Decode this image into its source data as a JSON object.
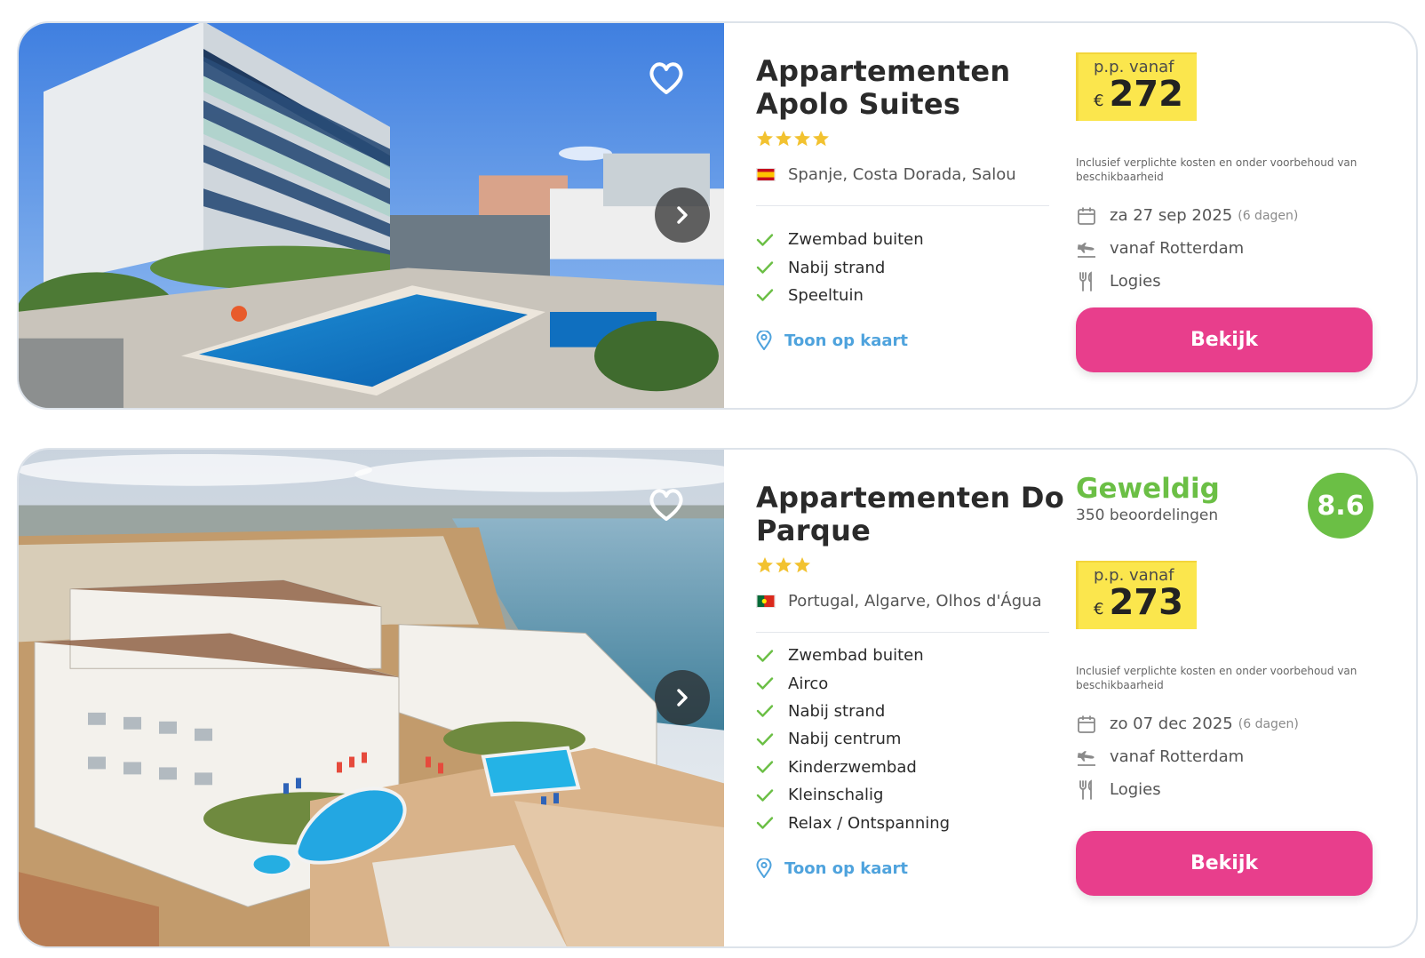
{
  "hotels": [
    {
      "name": "Appartementen Apolo Suites",
      "stars": 4,
      "flag": "es",
      "location": "Spanje, Costa Dorada, Salou",
      "features": [
        "Zwembad buiten",
        "Nabij strand",
        "Speeltuin"
      ],
      "map_link": "Toon op kaart",
      "price_label": "p.p. vanaf",
      "currency": "€",
      "price": "272",
      "disclaimer": "Inclusief verplichte kosten en onder voorbehoud van beschikbaarheid",
      "date": "za 27 sep 2025",
      "duration": "(6 dagen)",
      "departure": "vanaf Rotterdam",
      "board": "Logies",
      "button": "Bekijk"
    },
    {
      "name": "Appartementen Do Parque",
      "stars": 3,
      "flag": "pt",
      "location": "Portugal, Algarve, Olhos d'Água",
      "features": [
        "Zwembad buiten",
        "Airco",
        "Nabij strand",
        "Nabij centrum",
        "Kinderzwembad",
        "Kleinschalig",
        "Relax / Ontspanning"
      ],
      "map_link": "Toon op kaart",
      "rating_word": "Geweldig",
      "rating_count": "350 beoordelingen",
      "rating_score": "8.6",
      "price_label": "p.p. vanaf",
      "currency": "€",
      "price": "273",
      "disclaimer": "Inclusief verplichte kosten en onder voorbehoud van beschikbaarheid",
      "date": "zo 07 dec 2025",
      "duration": "(6 dagen)",
      "departure": "vanaf Rotterdam",
      "board": "Logies",
      "button": "Bekijk"
    }
  ],
  "colors": {
    "accent_button": "#e83e8c",
    "price_highlight": "#fbe64d",
    "rating_green": "#6bbf45",
    "link_blue": "#4fa3dd",
    "star_yellow": "#f2c230",
    "check_green": "#6bbf45"
  },
  "icons": [
    "heart-icon",
    "chevron-right-icon",
    "star-icon",
    "check-icon",
    "map-pin-icon",
    "calendar-icon",
    "plane-icon",
    "cutlery-icon"
  ]
}
